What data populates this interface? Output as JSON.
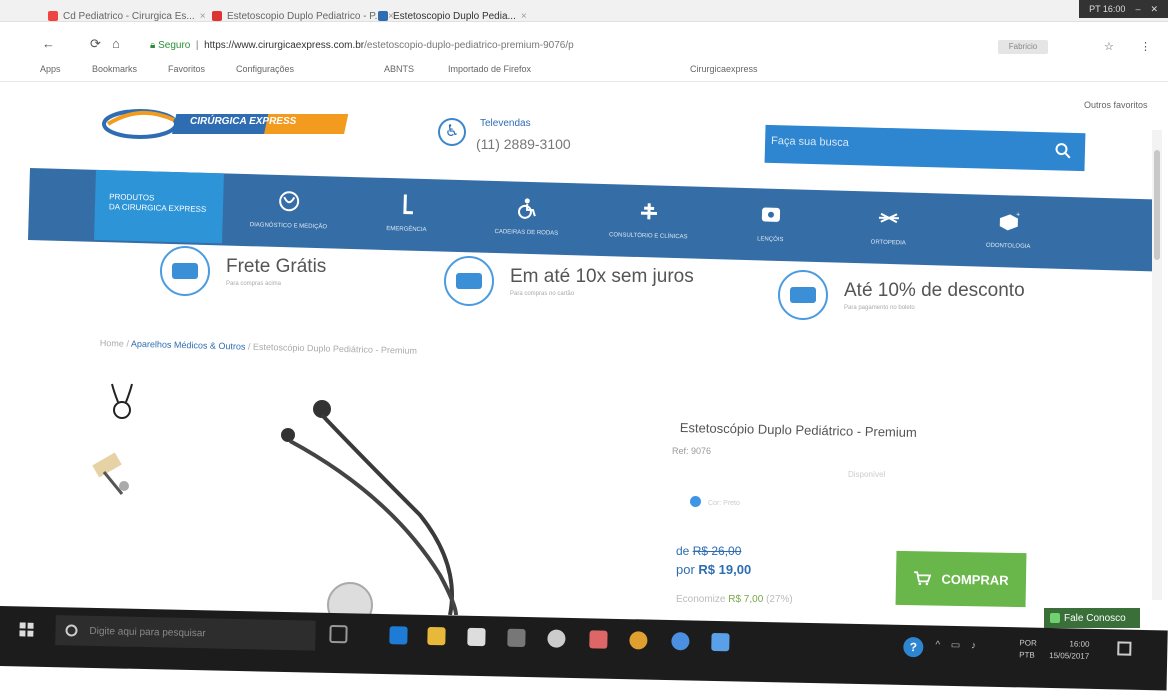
{
  "browser": {
    "tabs": [
      {
        "label": "Cd Pediatrico - Cirurgica Es..."
      },
      {
        "label": "Estetoscopio Duplo Pediatrico - P..."
      },
      {
        "label": "Estetoscopio Duplo Pedia..."
      }
    ],
    "url_secure": "Seguro",
    "url_domain": "https://www.cirurgicaexpress.com.br",
    "url_path": "/estetoscopio-duplo-pediatrico-premium-9076/p",
    "profile_label": "Fabricio",
    "bookmarks": [
      "Apps",
      "Bookmarks",
      "Favoritos",
      "Configurações",
      "ABNTS",
      "Importado de Firefox",
      "Cirurgicaexpress",
      "Outros favoritos"
    ],
    "window_controls": "PT 16:00"
  },
  "header": {
    "logo_text": "CIRÚRGICA EXPRESS",
    "phone_label": "Televendas",
    "phone_number": "(11) 2889-3100",
    "search_placeholder": "Faça sua busca"
  },
  "nav": {
    "first_line1": "PRODUTOS",
    "first_line2": "DA CIRURGICA EXPRESS",
    "items": [
      {
        "label": "Diagnóstico e Medição"
      },
      {
        "label": "Emergência"
      },
      {
        "label": "Cadeiras de Rodas"
      },
      {
        "label": "Consultório e Clínicas"
      },
      {
        "label": "Lençóis"
      },
      {
        "label": "Ortopedia"
      },
      {
        "label": "Odontologia"
      }
    ]
  },
  "benefits": [
    {
      "title": "Frete Grátis",
      "sub": "Para compras acima"
    },
    {
      "title": "Em até 10x sem juros",
      "sub": "Para compras no cartão"
    },
    {
      "title": "Até 10% de desconto",
      "sub": "Para pagamento no boleto"
    }
  ],
  "breadcrumb": {
    "home": "Home",
    "category": "Aparelhos Médicos & Outros",
    "current": "Estetoscópio Duplo Pediátrico - Premium"
  },
  "product": {
    "title": "Estetoscópio Duplo Pediátrico - Premium",
    "ref": "Ref: 9076",
    "availability": "Disponível",
    "color_label": "Cor: Preto",
    "price_old_prefix": "de",
    "price_old": "R$ 26,00",
    "price_new_prefix": "por",
    "price_new": "R$ 19,00",
    "economy_label": "Economize",
    "economy_amount": "R$ 7,00",
    "economy_pct": "(27%)",
    "buy_label": "COMPRAR"
  },
  "taskbar": {
    "search_placeholder": "Digite aqui para pesquisar",
    "lang_line1": "POR",
    "lang_line2": "PTB",
    "time": "16:00",
    "date": "15/05/2017"
  },
  "chat": {
    "label": "Fale Conosco"
  },
  "colors": {
    "brand_blue": "#356ea6",
    "accent_blue": "#2d94d8",
    "buy_green": "#69b64b"
  }
}
